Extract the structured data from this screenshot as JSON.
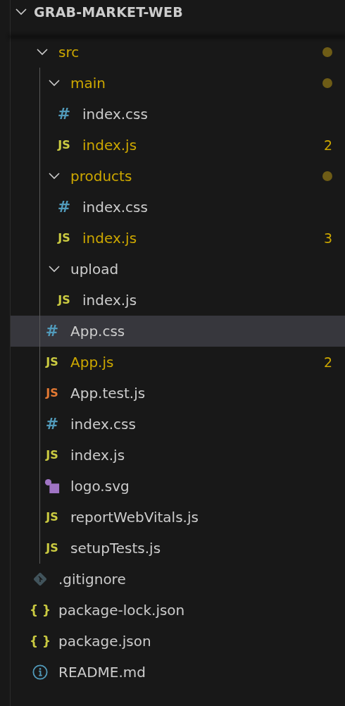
{
  "explorer": {
    "title": "GRAB-MARKET-WEB",
    "expanded": true,
    "tree": [
      {
        "name": "src",
        "kind": "folder",
        "expanded": true,
        "modified": true,
        "selected": false,
        "children": [
          {
            "name": "main",
            "kind": "folder",
            "expanded": true,
            "modified": true,
            "selected": false,
            "children": [
              {
                "name": "index.css",
                "kind": "css",
                "glyph": "#",
                "modified": false,
                "selected": false
              },
              {
                "name": "index.js",
                "kind": "js",
                "glyph": "JS",
                "modified": true,
                "badge": "2",
                "selected": false
              }
            ]
          },
          {
            "name": "products",
            "kind": "folder",
            "expanded": true,
            "modified": true,
            "selected": false,
            "children": [
              {
                "name": "index.css",
                "kind": "css",
                "glyph": "#",
                "modified": false,
                "selected": false
              },
              {
                "name": "index.js",
                "kind": "js",
                "glyph": "JS",
                "modified": true,
                "badge": "3",
                "selected": false
              }
            ]
          },
          {
            "name": "upload",
            "kind": "folder",
            "expanded": true,
            "modified": false,
            "selected": false,
            "children": [
              {
                "name": "index.js",
                "kind": "js",
                "glyph": "JS",
                "modified": false,
                "selected": false
              }
            ]
          },
          {
            "name": "App.css",
            "kind": "css",
            "glyph": "#",
            "modified": false,
            "selected": true
          },
          {
            "name": "App.js",
            "kind": "js",
            "glyph": "JS",
            "modified": true,
            "badge": "2",
            "selected": false
          },
          {
            "name": "App.test.js",
            "kind": "test",
            "glyph": "JS",
            "modified": false,
            "selected": false
          },
          {
            "name": "index.css",
            "kind": "css",
            "glyph": "#",
            "modified": false,
            "selected": false
          },
          {
            "name": "index.js",
            "kind": "js",
            "glyph": "JS",
            "modified": false,
            "selected": false
          },
          {
            "name": "logo.svg",
            "kind": "svg",
            "modified": false,
            "selected": false
          },
          {
            "name": "reportWebVitals.js",
            "kind": "js",
            "glyph": "JS",
            "modified": false,
            "selected": false
          },
          {
            "name": "setupTests.js",
            "kind": "js",
            "glyph": "JS",
            "modified": false,
            "selected": false
          }
        ]
      },
      {
        "name": ".gitignore",
        "kind": "git",
        "modified": false,
        "selected": false
      },
      {
        "name": "package-lock.json",
        "kind": "json",
        "glyph": "{ }",
        "modified": false,
        "selected": false
      },
      {
        "name": "package.json",
        "kind": "json",
        "glyph": "{ }",
        "modified": false,
        "selected": false
      },
      {
        "name": "README.md",
        "kind": "info",
        "modified": false,
        "selected": false
      }
    ]
  }
}
